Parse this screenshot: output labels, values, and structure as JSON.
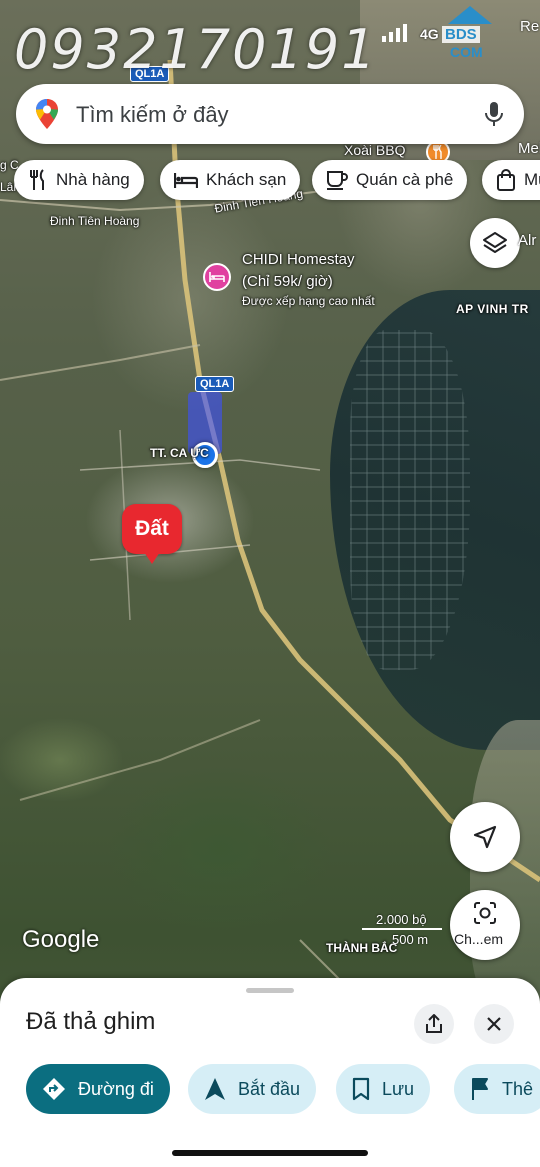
{
  "watermark": {
    "phone": "0932170191",
    "logo_text": "BDS",
    "logo_sub": "COM",
    "logo_color": "#2a8ec9"
  },
  "status_bar": {
    "network": "4G"
  },
  "edge_labels": {
    "top_right": "Re",
    "mid_right": "Mel",
    "layers_right": "Alr"
  },
  "search": {
    "placeholder": "Tìm kiếm ở đây"
  },
  "chips": [
    {
      "label": "Nhà hàng",
      "icon": "restaurant-icon"
    },
    {
      "label": "Khách sạn",
      "icon": "hotel-icon"
    },
    {
      "label": "Quán cà phê",
      "icon": "coffee-icon"
    },
    {
      "label": "Mu",
      "icon": "shopping-icon"
    }
  ],
  "map_labels": {
    "road_ql1a_top": "QL1A",
    "road_ql1a_mid": "QL1A",
    "xoai_bbq": "Xoài BBQ",
    "dinh_tien_hoang_left": "Đinh Tiên Hoàng",
    "dinh_tien_hoang_road": "Đinh Tiên Hoàng",
    "chidi_line1": "CHIDI Homestay",
    "chidi_line2": "(Chỉ 59k/ giờ)",
    "chidi_line3": "Được xếp hạng cao nhất",
    "ap_vinh": "AP VINH TR",
    "town": "TT. CA    ỰC",
    "thanh_bac": "THÀNH BẮC",
    "left_edge_1": "g C",
    "left_edge_2": "Lân"
  },
  "dropped_pin": {
    "label": "Đất",
    "color": "#e8282f"
  },
  "lens": {
    "label": "Ch...em"
  },
  "google_logo": "Google",
  "scale": {
    "line1": "2.000 bộ",
    "line2": "500 m"
  },
  "sheet": {
    "title": "Đã thả ghim",
    "actions": [
      {
        "label": "Đường đi",
        "icon": "directions-icon",
        "style": "primary"
      },
      {
        "label": "Bắt đầu",
        "icon": "navigation-arrow-icon",
        "style": "secondary"
      },
      {
        "label": "Lưu",
        "icon": "bookmark-icon",
        "style": "secondary"
      },
      {
        "label": "Thê",
        "icon": "flag-icon",
        "style": "secondary"
      }
    ]
  },
  "colors": {
    "primary_action": "#0b6e80",
    "secondary_action": "#d6eef6",
    "location_dot": "#1a73e8",
    "hotel_poi": "#e041a0",
    "food_poi": "#f18b2a"
  }
}
